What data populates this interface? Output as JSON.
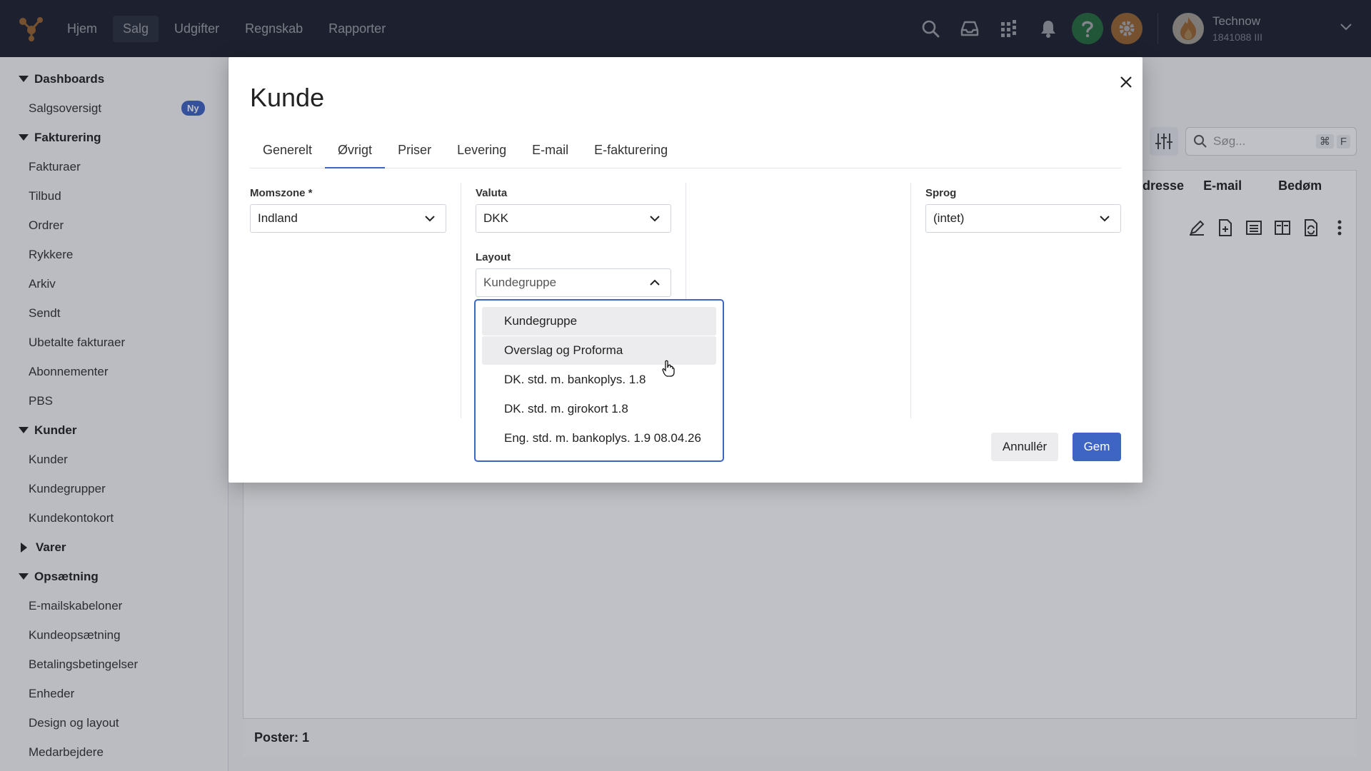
{
  "topnav": {
    "items": [
      {
        "label": "Hjem"
      },
      {
        "label": "Salg"
      },
      {
        "label": "Udgifter"
      },
      {
        "label": "Regnskab"
      },
      {
        "label": "Rapporter"
      }
    ],
    "active_index": 1,
    "user": {
      "name": "Technow",
      "sub": "1841088 III"
    },
    "colors": {
      "help": "#2e9b4f",
      "settings": "#e2913b"
    }
  },
  "sidebar": {
    "dashboards": {
      "label": "Dashboards",
      "items": [
        {
          "label": "Salgsoversigt",
          "badge": "Ny"
        }
      ]
    },
    "fakturering": {
      "label": "Fakturering",
      "items": [
        {
          "label": "Fakturaer"
        },
        {
          "label": "Tilbud"
        },
        {
          "label": "Ordrer"
        },
        {
          "label": "Rykkere"
        },
        {
          "label": "Arkiv"
        },
        {
          "label": "Sendt"
        },
        {
          "label": "Ubetalte fakturaer"
        },
        {
          "label": "Abonnementer"
        },
        {
          "label": "PBS"
        }
      ]
    },
    "kunder": {
      "label": "Kunder",
      "items": [
        {
          "label": "Kunder"
        },
        {
          "label": "Kundegrupper"
        },
        {
          "label": "Kundekontokort"
        }
      ]
    },
    "varer": {
      "label": "Varer"
    },
    "opsaetning": {
      "label": "Opsætning",
      "items": [
        {
          "label": "E-mailskabeloner"
        },
        {
          "label": "Kundeopsætning"
        },
        {
          "label": "Betalingsbetingelser"
        },
        {
          "label": "Enheder"
        },
        {
          "label": "Design og layout"
        },
        {
          "label": "Medarbejdere"
        }
      ]
    }
  },
  "background": {
    "search_placeholder": "Søg...",
    "kbd": [
      "⌘",
      "F"
    ],
    "headers": [
      "dresse",
      "E-mail",
      "Bedøm"
    ],
    "footer": "Poster: 1"
  },
  "modal": {
    "title": "Kunde",
    "tabs": [
      "Generelt",
      "Øvrigt",
      "Priser",
      "Levering",
      "E-mail",
      "E-fakturering"
    ],
    "active_tab": 1,
    "fields": {
      "momszone": {
        "label": "Momszone *",
        "value": "Indland"
      },
      "valuta": {
        "label": "Valuta",
        "value": "DKK"
      },
      "layout": {
        "label": "Layout",
        "value": "Kundegruppe"
      },
      "sprog": {
        "label": "Sprog",
        "value": "(intet)"
      }
    },
    "layout_options": [
      "Kundegruppe",
      "Overslag og Proforma",
      "DK. std. m. bankoplys. 1.8",
      "DK. std. m. girokort 1.8",
      "Eng. std. m. bankoplys. 1.9 08.04.26"
    ],
    "buttons": {
      "cancel": "Annullér",
      "save": "Gem"
    }
  },
  "colors": {
    "accent": "#3f65c4",
    "nav_bg": "#262a3b"
  }
}
